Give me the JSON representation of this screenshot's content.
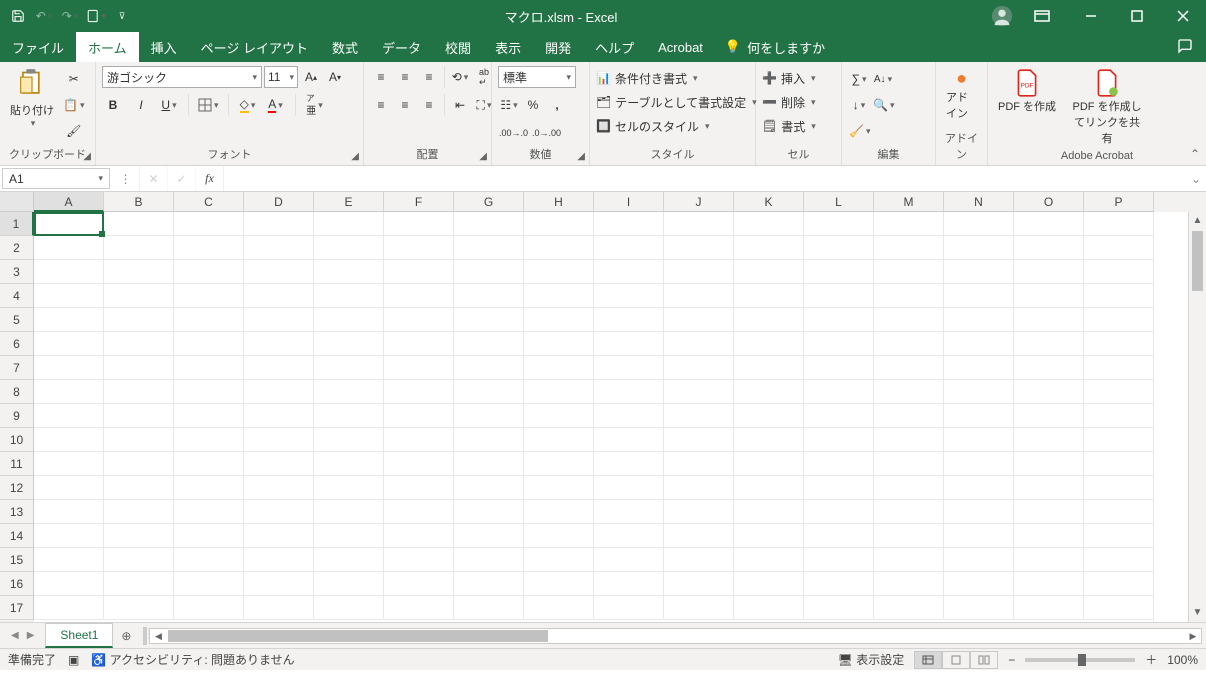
{
  "title": "マクロ.xlsm  -  Excel",
  "qat": {
    "save": "💾",
    "undo": "↶",
    "redo": "↷",
    "touch": "👆"
  },
  "tabs": [
    "ファイル",
    "ホーム",
    "挿入",
    "ページ レイアウト",
    "数式",
    "データ",
    "校閲",
    "表示",
    "開発",
    "ヘルプ",
    "Acrobat"
  ],
  "tellme": "何をしますか",
  "groups": {
    "clipboard": "クリップボード",
    "paste": "貼り付け",
    "font": "フォント",
    "fontName": "游ゴシック",
    "fontSize": "11",
    "alignment": "配置",
    "number": "数値",
    "numberFormat": "標準",
    "styles": "スタイル",
    "condFmt": "条件付き書式",
    "tableFmt": "テーブルとして書式設定",
    "cellStyles": "セルのスタイル",
    "cells": "セル",
    "insert": "挿入",
    "delete": "削除",
    "format": "書式",
    "editing": "編集",
    "addins": "アドイン",
    "addin": "アドイン",
    "acrobat": "Adobe Acrobat",
    "pdfCreate": "PDF を作成",
    "pdfShare": "PDF を作成してリンクを共有"
  },
  "namebox": "A1",
  "columns": [
    "A",
    "B",
    "C",
    "D",
    "E",
    "F",
    "G",
    "H",
    "I",
    "J",
    "K",
    "L",
    "M",
    "N",
    "O",
    "P"
  ],
  "rows": [
    "1",
    "2",
    "3",
    "4",
    "5",
    "6",
    "7",
    "8",
    "9",
    "10",
    "11",
    "12",
    "13",
    "14",
    "15",
    "16",
    "17"
  ],
  "sheet": "Sheet1",
  "status": {
    "ready": "準備完了",
    "accessibility": "アクセシビリティ: 問題ありません",
    "display": "表示設定",
    "zoom": "100%"
  }
}
